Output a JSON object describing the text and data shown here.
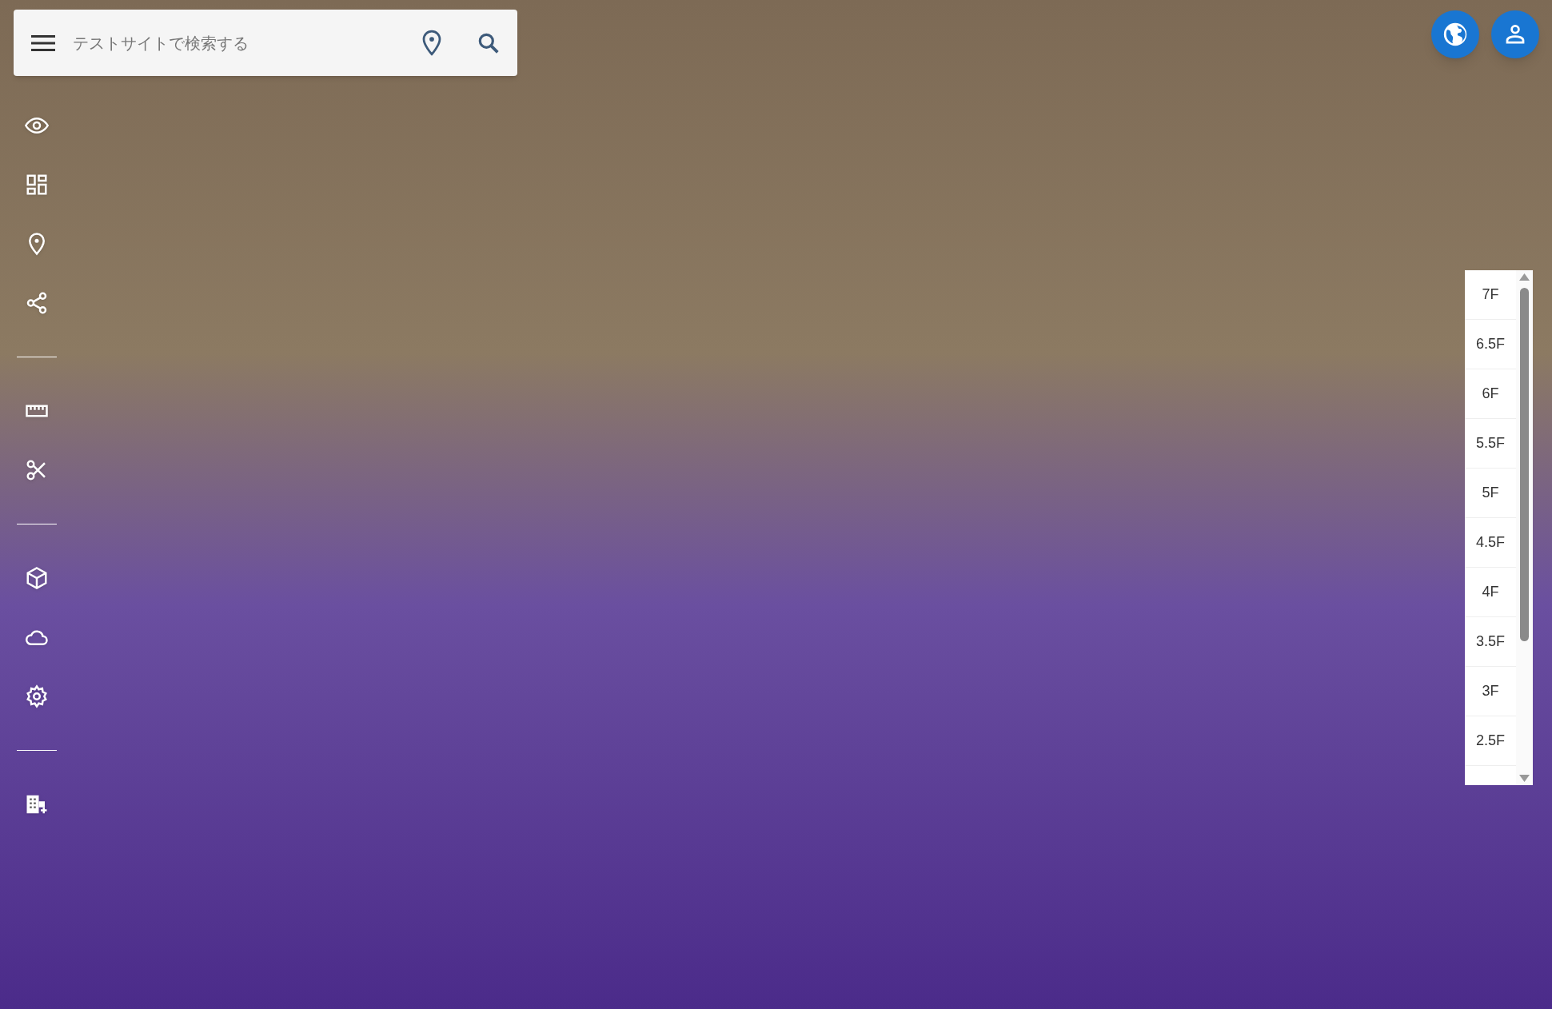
{
  "search": {
    "placeholder": "テストサイトで検索する"
  },
  "floors": [
    {
      "label": "7F"
    },
    {
      "label": "6.5F"
    },
    {
      "label": "6F"
    },
    {
      "label": "5.5F"
    },
    {
      "label": "5F"
    },
    {
      "label": "4.5F"
    },
    {
      "label": "4F"
    },
    {
      "label": "3.5F"
    },
    {
      "label": "3F"
    },
    {
      "label": "2.5F"
    }
  ]
}
